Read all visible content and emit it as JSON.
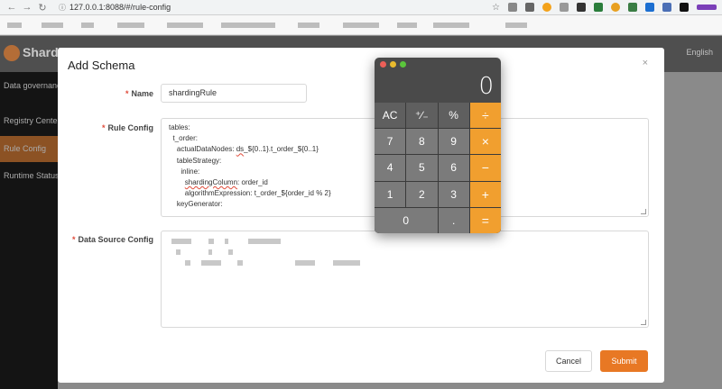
{
  "browser": {
    "url": "127.0.0.1:8088/#/rule-config"
  },
  "app": {
    "brand": "Shardin",
    "language": "English",
    "sidebar": [
      {
        "label": "Data governance"
      },
      {
        "label": "Registry Center"
      },
      {
        "label": "Rule Config"
      },
      {
        "label": "Runtime Status"
      }
    ]
  },
  "modal": {
    "title": "Add Schema",
    "close_glyph": "×",
    "name_label": "Name",
    "name_value": "shardingRule",
    "rule_label": "Rule Config",
    "rule_lines": [
      "tables:",
      "  t_order:",
      "    actualDataNodes: ",
      "    tableStrategy:",
      "      inline:",
      "        ",
      "        algorithmExpression: t_order_${order_id % 2}",
      "    keyGenerator:"
    ],
    "rule_ds_word": "ds",
    "rule_ds_rest": "_${0..1}.t_order_${0..1}",
    "rule_sharding_word": "shardingColumn",
    "rule_sharding_rest": ": order_id",
    "ds_label": "Data Source Config",
    "cancel_label": "Cancel",
    "submit_label": "Submit"
  },
  "calculator": {
    "display": "0",
    "keys": [
      {
        "label": "AC",
        "kind": "fn"
      },
      {
        "label": "⁺∕₋",
        "kind": "fn"
      },
      {
        "label": "%",
        "kind": "fn"
      },
      {
        "label": "÷",
        "kind": "op"
      },
      {
        "label": "7",
        "kind": "num"
      },
      {
        "label": "8",
        "kind": "num"
      },
      {
        "label": "9",
        "kind": "num"
      },
      {
        "label": "×",
        "kind": "op"
      },
      {
        "label": "4",
        "kind": "num"
      },
      {
        "label": "5",
        "kind": "num"
      },
      {
        "label": "6",
        "kind": "num"
      },
      {
        "label": "−",
        "kind": "op"
      },
      {
        "label": "1",
        "kind": "num"
      },
      {
        "label": "2",
        "kind": "num"
      },
      {
        "label": "3",
        "kind": "num"
      },
      {
        "label": "+",
        "kind": "op"
      },
      {
        "label": "0",
        "kind": "num zero"
      },
      {
        "label": ".",
        "kind": "num"
      },
      {
        "label": "=",
        "kind": "op"
      }
    ]
  },
  "colors": {
    "accent": "#e87824",
    "calc_operator": "#f19f2f",
    "sidebar_active": "#b5672a"
  }
}
